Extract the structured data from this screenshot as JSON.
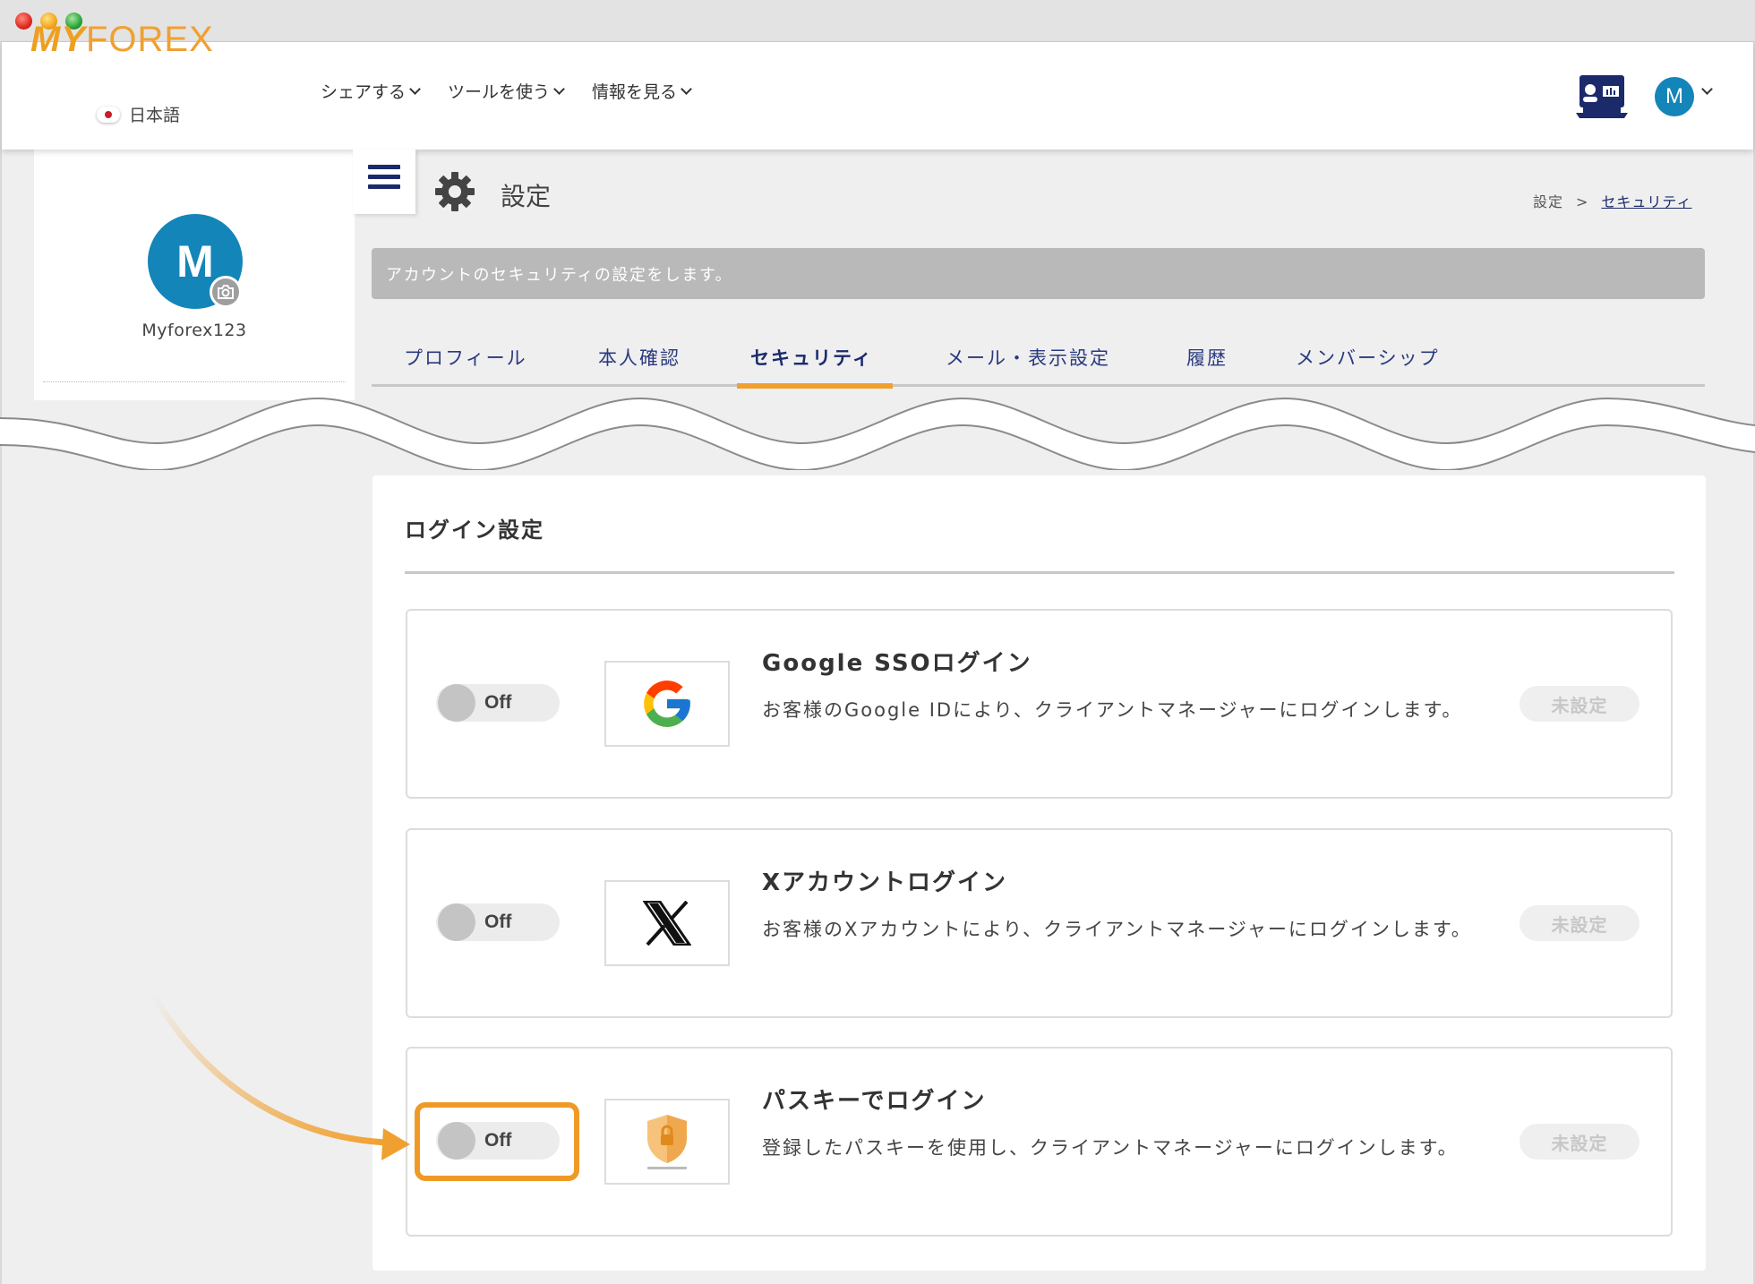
{
  "header": {
    "logo_my": "MY",
    "logo_forex": "FOREX",
    "language": "日本語",
    "nav": [
      {
        "label": "シェアする"
      },
      {
        "label": "ツールを使う"
      },
      {
        "label": "情報を見る"
      }
    ],
    "user_initial": "M"
  },
  "sidebar": {
    "avatar_initial": "M",
    "username": "Myforex123"
  },
  "page": {
    "title": "設定",
    "breadcrumb": {
      "root": "設定",
      "separator": ">",
      "current": "セキュリティ"
    },
    "info": "アカウントのセキュリティの設定をします。",
    "tabs": [
      {
        "label": "プロフィール"
      },
      {
        "label": "本人確認"
      },
      {
        "label": "セキュリティ",
        "active": true
      },
      {
        "label": "メール・表示設定"
      },
      {
        "label": "履歴"
      },
      {
        "label": "メンバーシップ"
      }
    ]
  },
  "login_settings": {
    "title": "ログイン設定",
    "items": [
      {
        "toggle": "Off",
        "icon": "google-logo-icon",
        "title": "Google SSOログイン",
        "description": "お客様のGoogle IDにより、クライアントマネージャーにログインします。",
        "status": "未設定"
      },
      {
        "toggle": "Off",
        "icon": "x-logo-icon",
        "title": "Xアカウントログイン",
        "description": "お客様のXアカウントにより、クライアントマネージャーにログインします。",
        "status": "未設定"
      },
      {
        "toggle": "Off",
        "icon": "passkey-shield-icon",
        "title": "パスキーでログイン",
        "description": "登録したパスキーを使用し、クライアントマネージャーにログインします。",
        "status": "未設定"
      }
    ]
  },
  "colors": {
    "accent": "#f0a030",
    "navy": "#1b2a6b",
    "avatar": "#1385b9"
  }
}
